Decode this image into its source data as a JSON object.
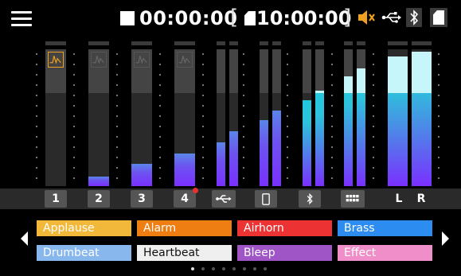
{
  "header": {
    "transport_state": "stopped",
    "elapsed_time": "00:00:00",
    "bracket_open": "[",
    "remaining_time": "10:00:00",
    "bracket_close": "]",
    "status_icons": [
      "mute-icon",
      "usb-icon",
      "bluetooth-icon",
      "sd-card-icon"
    ]
  },
  "meters": {
    "channels": [
      {
        "label": "1",
        "input_icon": "waveform-icon",
        "icon_active": true,
        "level": 0.0,
        "record_armed": false
      },
      {
        "label": "2",
        "input_icon": "waveform-icon",
        "icon_active": false,
        "level": 0.07,
        "record_armed": false
      },
      {
        "label": "3",
        "input_icon": "waveform-icon",
        "icon_active": false,
        "level": 0.16,
        "record_armed": false
      },
      {
        "label": "4",
        "input_icon": "waveform-icon",
        "icon_active": false,
        "level": 0.24,
        "record_armed": true
      }
    ],
    "stereo_sources": [
      {
        "name": "USB",
        "icon": "usb-icon",
        "levels": [
          0.32,
          0.4
        ]
      },
      {
        "name": "Phone",
        "icon": "smartphone-icon",
        "levels": [
          0.48,
          0.55
        ]
      },
      {
        "name": "Bluetooth",
        "icon": "bluetooth-icon",
        "levels": [
          0.63,
          0.7
        ]
      },
      {
        "name": "Pads",
        "icon": "pads-icon",
        "levels": [
          0.8,
          0.86
        ]
      }
    ],
    "master": [
      {
        "label": "L",
        "level": 0.95
      },
      {
        "label": "R",
        "level": 0.98
      }
    ]
  },
  "scenes": {
    "left_arrow": "previous-page-icon",
    "right_arrow": "next-page-icon",
    "pads": [
      {
        "label": "Applause",
        "color": "#f2b83a"
      },
      {
        "label": "Alarm",
        "color": "#ee7d12"
      },
      {
        "label": "Airhorn",
        "color": "#ec3232"
      },
      {
        "label": "Brass",
        "color": "#2c8cf0"
      },
      {
        "label": "Drumbeat",
        "color": "#87b7ec"
      },
      {
        "label": "Heartbeat",
        "color": "#efefef",
        "text_color": "#111111"
      },
      {
        "label": "Bleep",
        "color": "#a055c6"
      },
      {
        "label": "Effect",
        "color": "#ef8ec9"
      }
    ],
    "page_count": 8,
    "current_page": 1
  }
}
